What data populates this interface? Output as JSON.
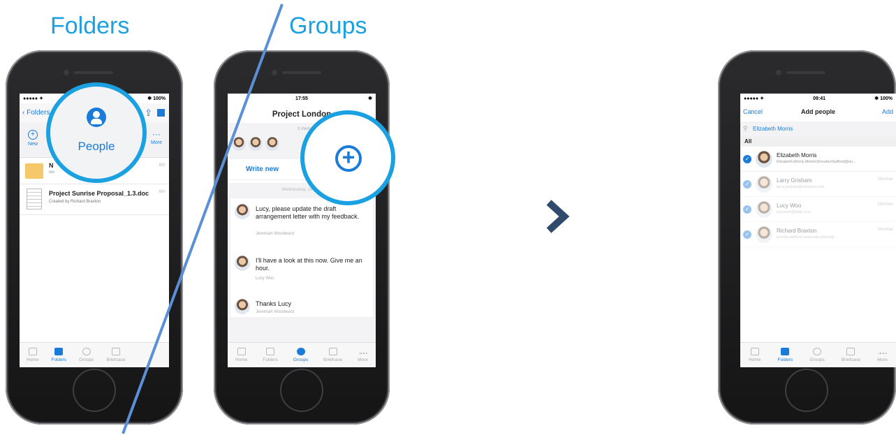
{
  "labels": {
    "folders": "Folders",
    "groups": "Groups"
  },
  "phone1": {
    "status": {
      "left": "●●●●● ✦",
      "right": "✱ 100%"
    },
    "nav": {
      "back": "Folders"
    },
    "toolbar": {
      "new": "New",
      "more": "More"
    },
    "files": [
      {
        "name": "N",
        "sub": "ow",
        "size": "6M"
      },
      {
        "name": "Project Sunrise Proposal_1.3.doc",
        "sub": "Created by Richard Braxton",
        "size": "6M"
      }
    ],
    "callout": {
      "label": "People"
    },
    "tabs": [
      "Home",
      "Folders",
      "Groups",
      "Briefcase"
    ]
  },
  "phone2": {
    "status": {
      "time": "17:55",
      "right": "✱"
    },
    "title": "Project London",
    "members": "3 mem",
    "write_new": "Write new",
    "date": "Wednesday, 24 Aug",
    "messages": [
      {
        "text": "Lucy, please update the draft arrangement letter with my feedback.",
        "author": "Jeremiah Woodward"
      },
      {
        "text": "I'll have a look at this now. Give me an hour.",
        "author": "Lucy Woo"
      },
      {
        "text": "Thanks Lucy",
        "author": "Jeremiah Woodward"
      }
    ],
    "tabs": [
      "Home",
      "Folders",
      "Groups",
      "Briefcase",
      "More"
    ]
  },
  "chevron": "›",
  "phone3": {
    "status": {
      "left": "●●●●● ✦",
      "time": "09:41",
      "right": "✱ 100%"
    },
    "nav": {
      "cancel": "Cancel",
      "title": "Add people",
      "add": "Add"
    },
    "search": {
      "value": "Elizabeth Morris"
    },
    "section": "All",
    "people": [
      {
        "name": "Elizabeth Morris",
        "email": "Elizabeth.Morris.MintonDresdenStafford@ou...",
        "role": ""
      },
      {
        "name": "Larry Grisham",
        "email": "larry.grisham@mintons.com",
        "role": "Member"
      },
      {
        "name": "Lucy Woo",
        "email": "lucy.woo@brite.com",
        "role": "Member"
      },
      {
        "name": "Richard Braxton",
        "email": "jeremy.stafford.mintondresdene@...",
        "role": "Member"
      }
    ],
    "tabs": [
      "Home",
      "Folders",
      "Groups",
      "Briefcase",
      "More"
    ]
  },
  "colors": {
    "accent": "#1ba1e2",
    "ios_blue": "#1a7bd8",
    "divider": "#5b8fd6"
  }
}
